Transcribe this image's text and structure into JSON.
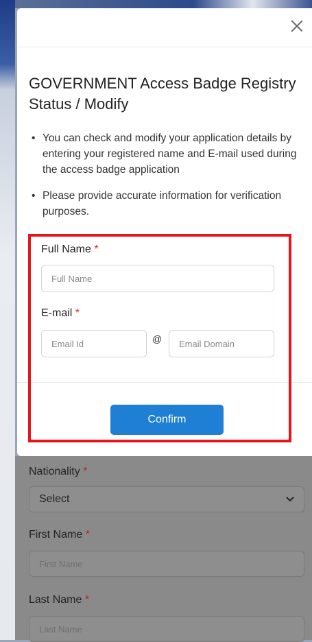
{
  "modal": {
    "title": "GOVERNMENT Access Badge Registry Status / Modify",
    "bullets": [
      "You can check and modify your application details by entering your registered name and E-mail used during the access badge application",
      "Please provide accurate information for verification purposes."
    ],
    "full_name_label": "Full Name",
    "full_name_placeholder": "Full Name",
    "email_label": "E-mail",
    "email_id_placeholder": "Email Id",
    "at_sign": "@",
    "email_domain_placeholder": "Email Domain",
    "required_mark": "*",
    "confirm_label": "Confirm"
  },
  "background_form": {
    "nationality_label": "Nationality",
    "nationality_value": "Select",
    "first_name_label": "First Name",
    "first_name_placeholder": "First Name",
    "last_name_label": "Last Name",
    "last_name_placeholder": "Last Name",
    "required_mark": "*"
  },
  "colors": {
    "primary_button": "#1f7fd4",
    "required": "#d32f2f",
    "highlight": "#e8141a"
  }
}
